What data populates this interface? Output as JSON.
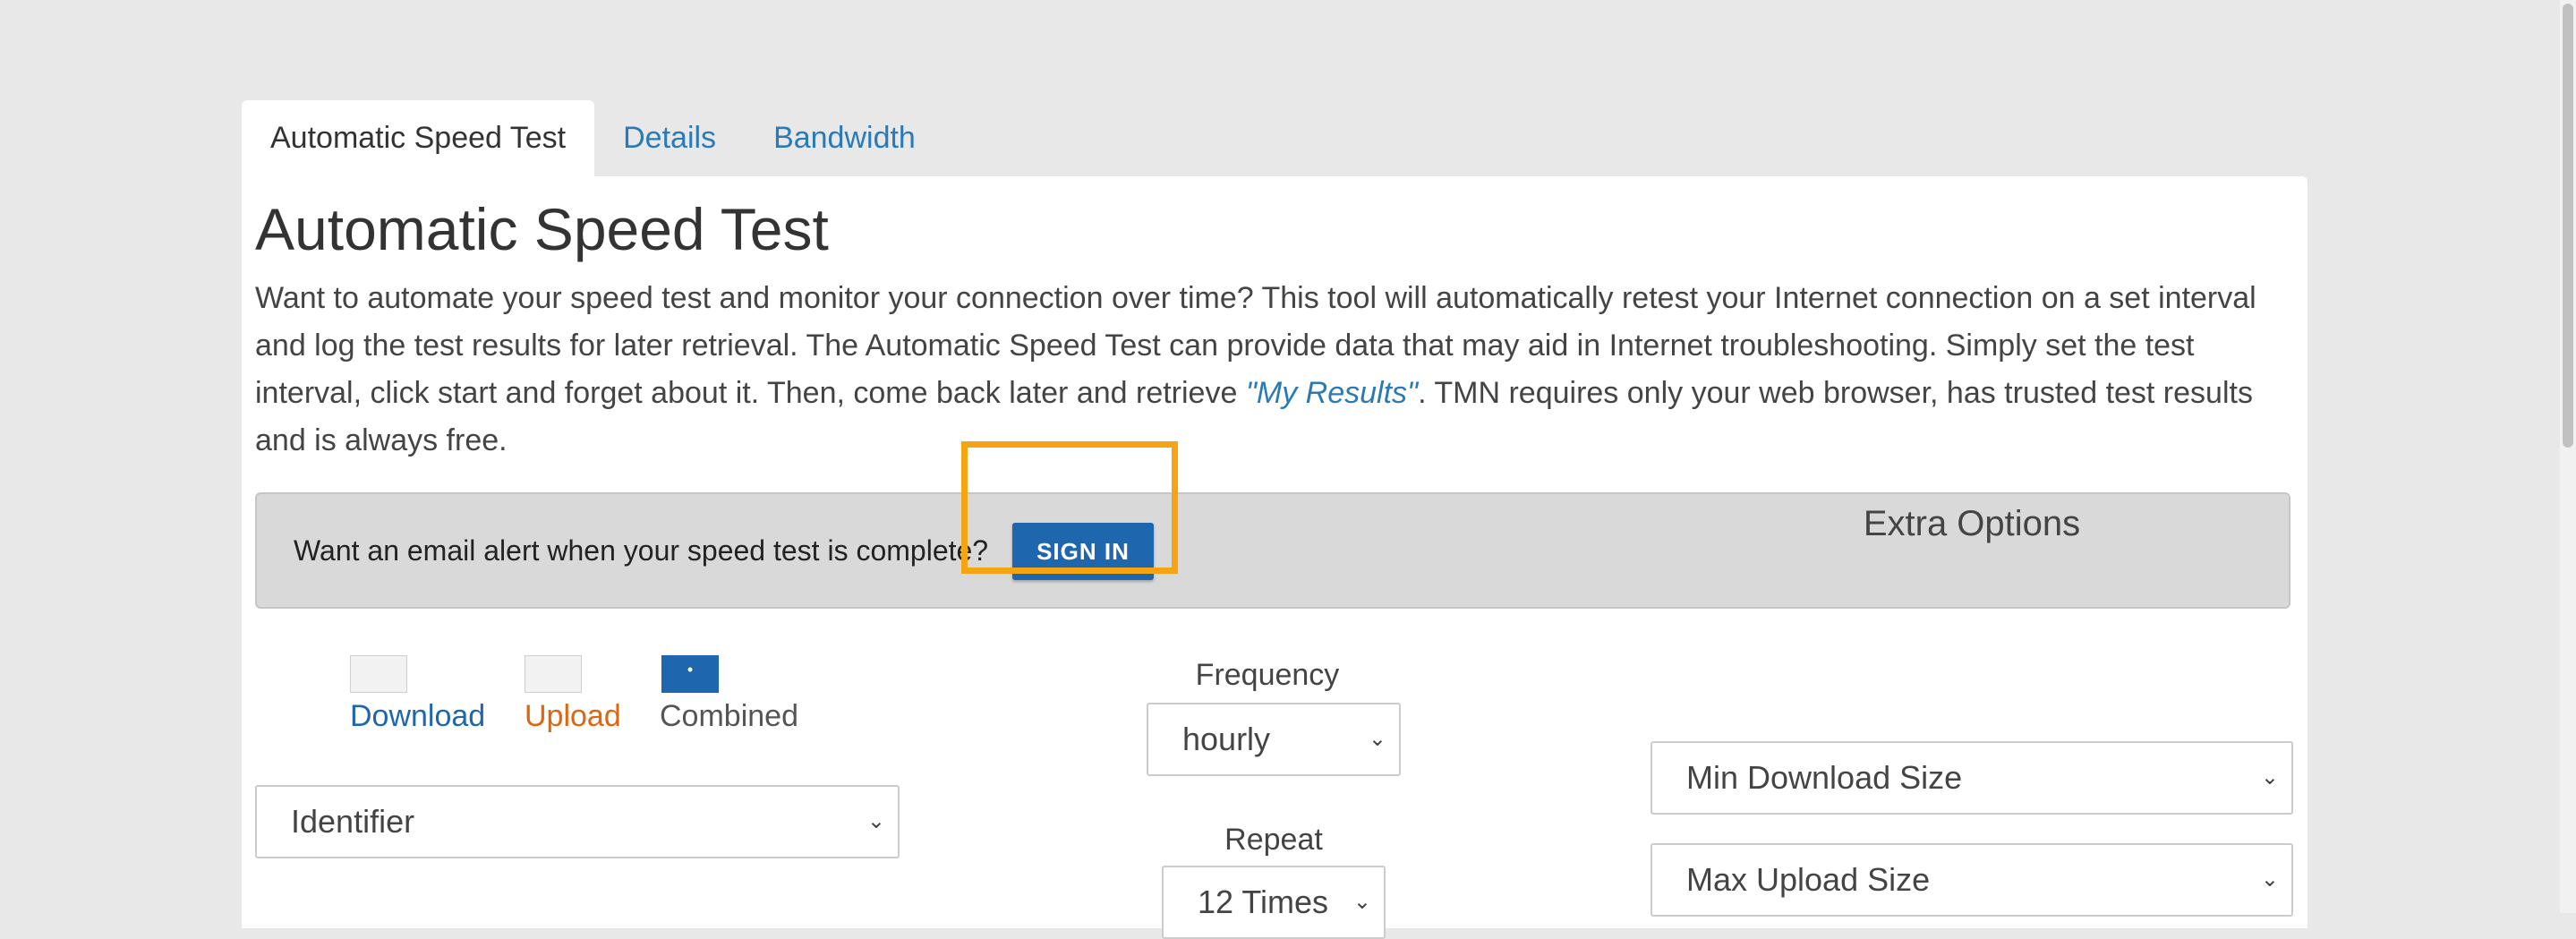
{
  "tabs": [
    {
      "label": "Automatic Speed Test",
      "active": true
    },
    {
      "label": "Details",
      "active": false
    },
    {
      "label": "Bandwidth",
      "active": false
    }
  ],
  "page": {
    "title": "Automatic Speed Test",
    "intro_text": "Want to automate your speed test and monitor your connection over time? This tool will automatically retest your Internet connection on a set interval and log the test results for later retrieval. The Automatic Speed Test can provide data that may aid in Internet troubleshooting. Simply set the test interval, click start and forget about it. Then, come back later and retrieve ",
    "intro_link": "\"My Results\"",
    "intro_text_end": ". TMN requires only your web browser, has trusted test results and is always free."
  },
  "alert": {
    "text": "Want an email alert when your speed test is complete?",
    "button_label": "SIGN IN"
  },
  "legend": [
    {
      "label": "Download",
      "color": "#1e67ae",
      "checked": false
    },
    {
      "label": "Upload",
      "color": "#e0650f",
      "checked": false
    },
    {
      "label": "Combined",
      "color": "#555555",
      "checked": true
    }
  ],
  "identifier": {
    "value": "Identifier"
  },
  "frequency": {
    "label": "Frequency",
    "value": "hourly"
  },
  "repeat": {
    "label": "Repeat",
    "value": "12 Times"
  },
  "extra_options": {
    "title": "Extra Options",
    "min_download": "Min Download Size",
    "max_upload": "Max Upload Size"
  },
  "colors": {
    "accent": "#1e67ae",
    "highlight": "#f5a511"
  }
}
